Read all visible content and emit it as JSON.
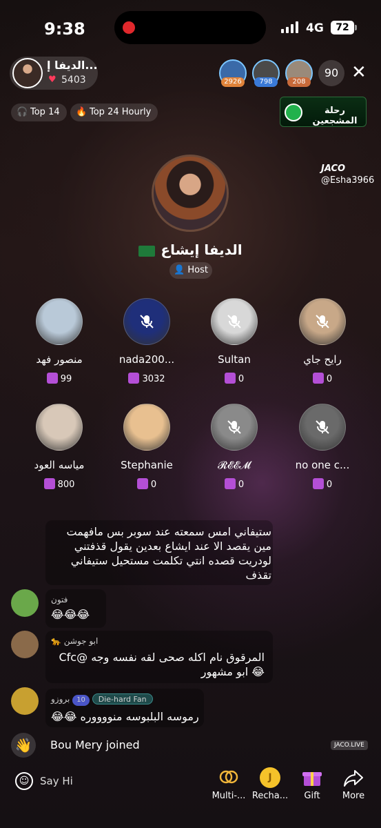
{
  "status_bar": {
    "time": "9:38",
    "network": "4G",
    "battery": "72"
  },
  "host": {
    "name_short": "الديفا إ...",
    "likes": "5403",
    "full_name": "الديفا إيشاع",
    "role": "Host"
  },
  "viewers": {
    "items": [
      {
        "badge": "2926",
        "badge_color": "#e0833a",
        "avatar_color": "#3a6aa8"
      },
      {
        "badge": "798",
        "badge_color": "#3a7ad8",
        "avatar_color": "#4a4a4a"
      },
      {
        "badge": "208",
        "badge_color": "#c86a3a",
        "avatar_color": "#9a8a7a"
      }
    ],
    "count": "90"
  },
  "chips": {
    "top_weekly": "Top 14",
    "top_hourly": "Top 24 Hourly"
  },
  "banner_text": "رحلة المشجعين",
  "brand": {
    "name": "JACO",
    "handle": "@Esha3966"
  },
  "seats": [
    {
      "name": "منصور فهد",
      "gifts": "99",
      "color": "#b9c9d8",
      "muted": false
    },
    {
      "name": "nada200...",
      "gifts": "3032",
      "color": "#1f2f7a",
      "muted": true
    },
    {
      "name": "Sultan",
      "gifts": "0",
      "color": "#d8d8d8",
      "muted": true
    },
    {
      "name": "رايح جاي",
      "gifts": "0",
      "color": "#c8a888",
      "muted": true
    },
    {
      "name": "مياسه العود",
      "gifts": "800",
      "color": "#d8c8b8",
      "muted": false
    },
    {
      "name": "Stephanie",
      "gifts": "0",
      "color": "#e8c090",
      "muted": false
    },
    {
      "name": "𝓡𝓔𝓔𝓜",
      "gifts": "0",
      "color": "#8a8a8a",
      "muted": true
    },
    {
      "name": "no one c...",
      "gifts": "0",
      "color": "#6a6a6a",
      "muted": true
    }
  ],
  "chat": [
    {
      "user": "",
      "text": "ستيفاني امس سمعته عند سوبر بس مافهمت\nمين يقصد الا عند ايشاع بعدين يقول قذفتني\nلودريت قصده انتي تكلمت مستحيل ستيفاني\nتقذف"
    },
    {
      "user": "فتون",
      "text": "😂😂😂"
    },
    {
      "user": "ابو جوشن",
      "text": "المرقوق نام اكله صحى لقه نفسه وجه @Cfc\n😂 ابو مشهور"
    },
    {
      "user": "بروزو",
      "level": "10",
      "fan_label": "Die-hard Fan",
      "text": "رموسه البلبوسه منووووره 😂😂"
    }
  ],
  "joined": "Bou Mery joined",
  "watermark": "JACO.LIVE",
  "bottom": {
    "say_hi": "Say Hi",
    "buttons": [
      {
        "label": "Multi-..."
      },
      {
        "label": "Recha..."
      },
      {
        "label": "Gift"
      },
      {
        "label": "More"
      }
    ]
  }
}
